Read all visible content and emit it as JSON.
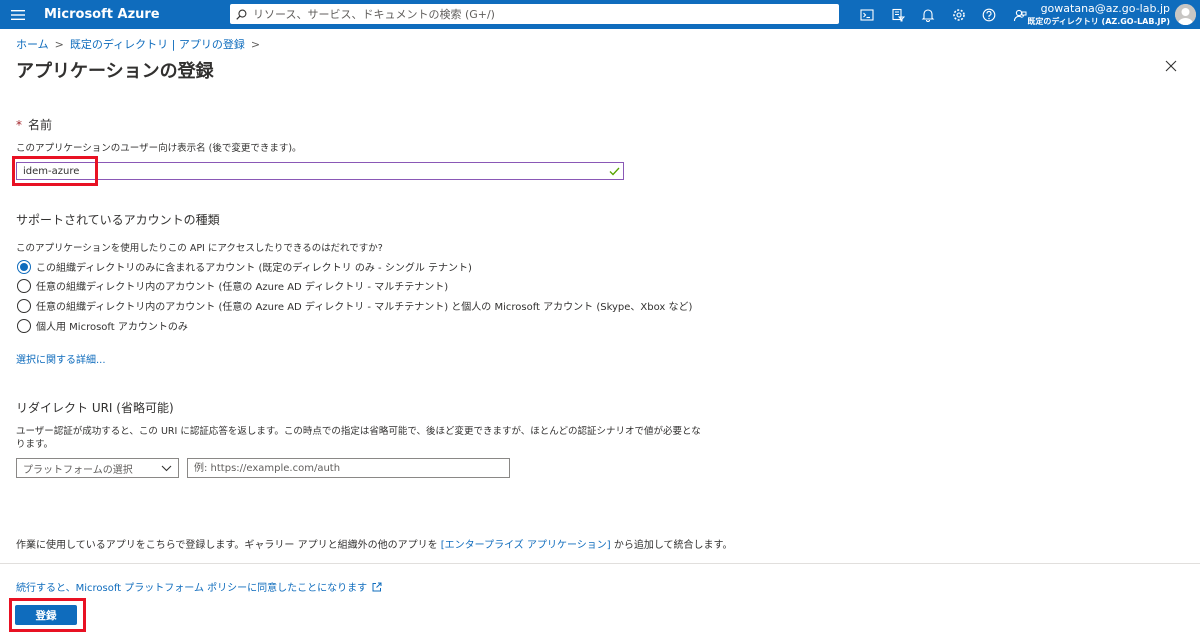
{
  "topbar": {
    "brand": "Microsoft Azure",
    "search_placeholder": "リソース、サービス、ドキュメントの検索 (G+/)",
    "icons": [
      "cloud-shell-icon",
      "directory-filter-icon",
      "notifications-icon",
      "settings-icon",
      "help-icon",
      "feedback-icon"
    ],
    "account_email": "gowatana@az.go-lab.jp",
    "account_tenant": "既定のディレクトリ (AZ.GO-LAB.JP)"
  },
  "breadcrumb": {
    "items": [
      "ホーム",
      "既定のディレクトリ | アプリの登録"
    ],
    "separator": ">"
  },
  "page": {
    "title": "アプリケーションの登録",
    "more": "···"
  },
  "name_section": {
    "required_mark": "*",
    "label": "名前",
    "help": "このアプリケーションのユーザー向け表示名 (後で変更できます)。",
    "value": "idem-azure"
  },
  "account_types": {
    "heading": "サポートされているアカウントの種類",
    "question": "このアプリケーションを使用したりこの API にアクセスしたりできるのはだれですか?",
    "options": [
      "この組織ディレクトリのみに含まれるアカウント (既定のディレクトリ のみ - シングル テナント)",
      "任意の組織ディレクトリ内のアカウント (任意の Azure AD ディレクトリ - マルチテナント)",
      "任意の組織ディレクトリ内のアカウント (任意の Azure AD ディレクトリ - マルチテナント) と個人の Microsoft アカウント (Skype、Xbox など)",
      "個人用 Microsoft アカウントのみ"
    ],
    "selected_index": 0,
    "details_link": "選択に関する詳細..."
  },
  "redirect": {
    "heading": "リダイレクト URI (省略可能)",
    "help_line1": "ユーザー認証が成功すると、この URI に認証応答を返します。この時点での指定は省略可能で、後ほど変更できますが、ほとんどの認証シナリオで値が必要とな",
    "help_line2": "ります。",
    "platform_placeholder": "プラットフォームの選択",
    "uri_placeholder": "例: https://example.com/auth"
  },
  "enterprise": {
    "before": "作業に使用しているアプリをこちらで登録します。ギャラリー アプリと組織外の他のアプリを ",
    "link": "[エンタープライズ アプリケーション]",
    "after": " から追加して統合します。"
  },
  "footer": {
    "policy": "続行すると、Microsoft プラットフォーム ポリシーに同意したことになります",
    "register": "登録"
  },
  "colors": {
    "accent": "#0f6cbd",
    "highlight": "#e81123",
    "input_focus": "#8a58b6",
    "valid_check": "#57a300"
  }
}
